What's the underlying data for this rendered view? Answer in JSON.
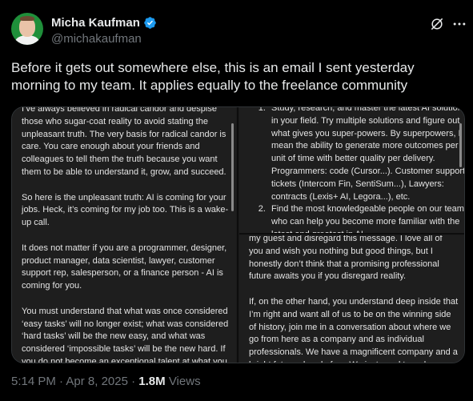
{
  "author": {
    "display_name": "Micha Kaufman",
    "handle": "@michakaufman",
    "verified_icon": "verified-badge-icon",
    "avatar": "avatar-photo"
  },
  "header_icons": {
    "grok": "grok-icon",
    "more": "more-icon"
  },
  "tweet": {
    "text": "Before it gets out somewhere else, this is an email I sent yesterday morning to my team. It applies equally to the freelance community"
  },
  "media": {
    "left": [
      "I’ve always believed in radical candor and despise those who sugar-coat reality to avoid stating the unpleasant truth. The very basis for radical candor is care. You care enough about your friends and colleagues to tell them the truth because you want them to be able to understand it, grow, and succeed.",
      "So here is the unpleasant truth: AI is coming for your jobs. Heck, it’s coming for my job too. This is a wake-up call.",
      "It does not matter if you are a programmer, designer, product manager, data scientist, lawyer, customer support rep, salesperson, or a finance person - AI is coming for you.",
      "You must understand that what was once considered ‘easy tasks’ will no longer exist; what was considered ‘hard tasks’ will be the new easy, and what was considered ‘impossible tasks’ will be the new hard. If you do not become an exceptional talent at what you"
    ],
    "right_top": [
      "Study, research, and master the latest AI solutions in your field. Try multiple solutions and figure out what gives you super-powers. By superpowers, I mean the ability to generate more outcomes per unit of time with better quality per delivery. Programmers: code (Cursor...). Customer support: tickets (Intercom Fin, SentiSum...), Lawyers: contracts (Lexis+ AI, Legora...), etc.",
      "Find the most knowledgeable people on our team who can help you become more familiar with the latest and greatest in AI"
    ],
    "right_bottom": [
      "my guest and disregard this message. I love all of you and wish you nothing but good things, but I honestly don’t think that a promising professional future awaits you if you disregard reality.",
      "If, on the other hand, you understand deep inside that I’m right and want all of us to be on the winning side of history, join me in a conversation about where we go from here as a company and as individual professionals. We have a magnificent company and a bright future ahead of us. We just need to wake up"
    ]
  },
  "meta": {
    "time": "5:14 PM",
    "separator": "·",
    "date": "Apr 8, 2025",
    "views_count": "1.8M",
    "views_label": "Views"
  },
  "colors": {
    "background": "#000000",
    "text": "#e7e9ea",
    "secondary": "#71767b",
    "verified": "#1d9bf0",
    "media_bg": "#1e1e1e"
  }
}
